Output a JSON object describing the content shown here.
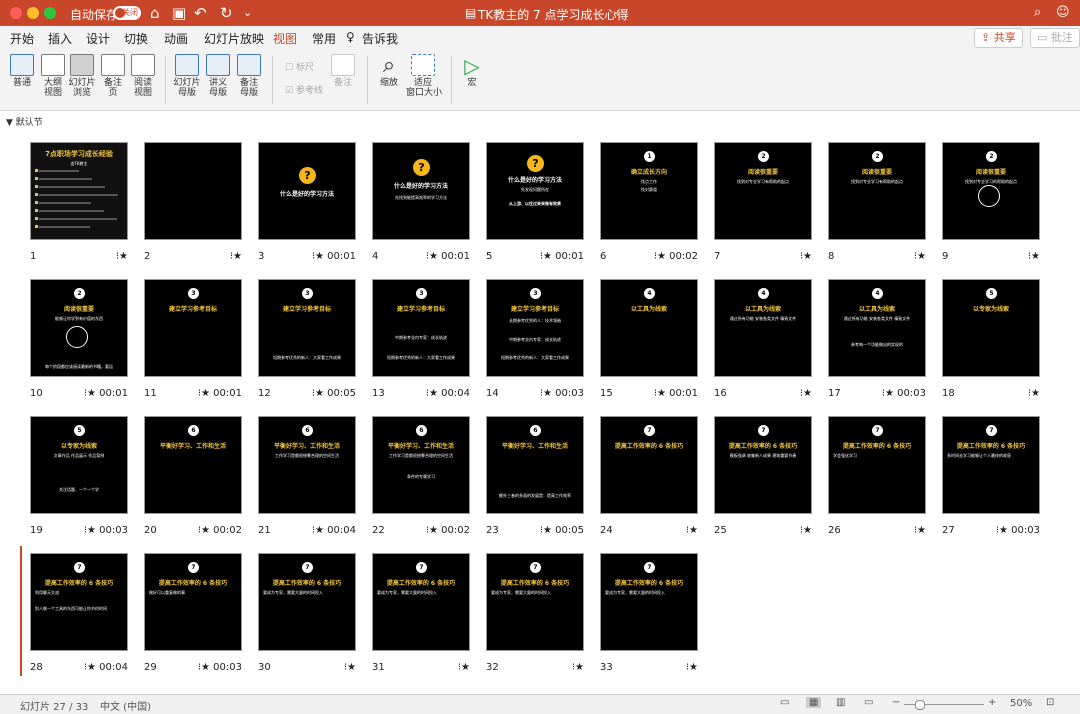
{
  "titlebar": {
    "autosave": "自动保存",
    "toggle": "关闭",
    "title": "TK教主的 7 点学习成长心得",
    "title_caret": "⌄"
  },
  "ribbon_tabs": [
    "开始",
    "插入",
    "设计",
    "切换",
    "动画",
    "幻灯片放映",
    "视图",
    "常用",
    "告诉我"
  ],
  "active_tab": "视图",
  "share": "共享",
  "comment": "批注",
  "toolbar": {
    "normal": "普通",
    "outline": "大纲\n视图",
    "sorter": "幻灯片\n浏览",
    "notes": "备注\n页",
    "reading": "阅读\n视图",
    "slide_master": "幻灯片\n母版",
    "handout_master": "讲义\n母版",
    "notes_master": "备注\n母版",
    "ruler": "标尺",
    "guides": "参考线",
    "notes2": "备注",
    "zoom": "缩放",
    "fit": "适应\n窗口大小",
    "macro": "宏"
  },
  "section": "默认节",
  "slides": [
    {
      "n": "1",
      "time": "",
      "star": true
    },
    {
      "n": "2",
      "time": "",
      "star": true
    },
    {
      "n": "3",
      "time": "00:01",
      "star": true
    },
    {
      "n": "4",
      "time": "00:01",
      "star": true
    },
    {
      "n": "5",
      "time": "00:01",
      "star": true
    },
    {
      "n": "6",
      "time": "00:02",
      "star": true
    },
    {
      "n": "7",
      "time": "",
      "star": true
    },
    {
      "n": "8",
      "time": "",
      "star": true
    },
    {
      "n": "9",
      "time": "",
      "star": true
    },
    {
      "n": "10",
      "time": "00:01",
      "star": true
    },
    {
      "n": "11",
      "time": "00:01",
      "star": true
    },
    {
      "n": "12",
      "time": "00:05",
      "star": true
    },
    {
      "n": "13",
      "time": "00:04",
      "star": true
    },
    {
      "n": "14",
      "time": "00:03",
      "star": true
    },
    {
      "n": "15",
      "time": "00:01",
      "star": true
    },
    {
      "n": "16",
      "time": "",
      "star": true
    },
    {
      "n": "17",
      "time": "00:03",
      "star": true
    },
    {
      "n": "18",
      "time": "",
      "star": true
    },
    {
      "n": "19",
      "time": "00:03",
      "star": true
    },
    {
      "n": "20",
      "time": "00:02",
      "star": true
    },
    {
      "n": "21",
      "time": "00:04",
      "star": true
    },
    {
      "n": "22",
      "time": "00:02",
      "star": true
    },
    {
      "n": "23",
      "time": "00:05",
      "star": true
    },
    {
      "n": "24",
      "time": "",
      "star": true
    },
    {
      "n": "25",
      "time": "",
      "star": true
    },
    {
      "n": "26",
      "time": "",
      "star": true
    },
    {
      "n": "27",
      "time": "00:03",
      "star": true
    },
    {
      "n": "28",
      "time": "00:04",
      "star": true
    },
    {
      "n": "29",
      "time": "00:03",
      "star": true
    },
    {
      "n": "30",
      "time": "",
      "star": true
    },
    {
      "n": "31",
      "time": "",
      "star": true
    },
    {
      "n": "32",
      "time": "",
      "star": true
    },
    {
      "n": "33",
      "time": "",
      "star": true
    }
  ],
  "slide_content": {
    "s1_title": "7点职场学习成长经验",
    "s1_sub": "由TK教主",
    "s3": "什么是好的学习方法",
    "s4": "什么是好的学习方法",
    "s4b": "先找到能提高效率的学习方法",
    "s5": "什么是好的学习方法",
    "s5b": "先发现问题所在",
    "s5c": "从上游、以往过来来做有效果",
    "s6": "确立成长方向",
    "s6b": "找点工作",
    "s6c": "找对赛道",
    "s7": "阅读很重要",
    "s7b": "找到对专业学习有帮助的起点",
    "s8": "阅读很重要",
    "s8b": "找到对专业学习有帮助的起点",
    "s9": "阅读很重要",
    "s9b": "找到对专业学习的帮助的起点",
    "s10": "阅读很重要",
    "s10b": "能够让你学到有价值的东西",
    "s10c": "每个阶段都应该阅读最新的书籍，要运",
    "s11": "建立学习参考目标",
    "s12": "建立学习参考目标",
    "s12b": "短期参考优秀的新人：大家看工作成果",
    "s13": "建立学习参考目标",
    "s13b": "中期参考业内专家：成长轨迹",
    "s13c": "短期参考优秀的新人：大家看工作成果",
    "s14": "建立学习参考目标",
    "s14b": "长期参考优秀的人：技术领袖",
    "s14c": "中期参考业内专家：成长轨迹",
    "s14d": "短期参考优秀的新人：大家看工作成果",
    "s15": "以工具为线索",
    "s16": "以工具为线索",
    "s16b": "通过所有功能    安装各类文件    精致文件",
    "s17": "以工具为线索",
    "s17b": "通过所有功能    安装各类文件    精致文件",
    "s17c": "参考每一个功能做出的实现的",
    "s18": "以专家为线索",
    "s19": "以专家为线索",
    "s19b": "文章作品    作品展示    作品案例",
    "s19c": "关注话题、一个一个学",
    "s20": "平衡好学习、工作和生活",
    "s21": "平衡好学习、工作和生活",
    "s21b": "工作学习是都很统筹合理的空间生活",
    "s22": "平衡好学习、工作和生活",
    "s22b": "工作学习是都很统筹合理的空间生活",
    "s22c": "条件的专属学习",
    "s23": "平衡好学习、工作和生活",
    "s23b": "额外三者的多面的发展是：提高工作效率",
    "s24": "提高工作效率的 6 条技巧",
    "s25": "提高工作效率的 6 条技巧",
    "s25b": "模板强调    收集新人成果    建筑重要节奏",
    "s26": "提高工作效率的 6 条技巧",
    "s26b": "学会强化学习",
    "s27": "提高工作效率的 6 条技巧",
    "s27b": "多时间去学习能够让个人最终的收获",
    "s28": "提高工作效率的 6 条技巧",
    "s28b": "利用聊天交流",
    "s28c": "别人做一个工具的东西可能让你节约时间",
    "s29": "提高工作效率的 6 条技巧",
    "s29b": "做好可以重复做的事",
    "s30": "提高工作效率的 6 条技巧",
    "s30b": "要成为专家，需要大量的时间投入",
    "s31": "提高工作效率的 6 条技巧",
    "s31b": "要成为专家，需要大量的时间投入",
    "s32": "提高工作效率的 6 条技巧",
    "s32b": "要成为专家，需要大量的时间投入",
    "s33": "提高工作效率的 6 条技巧",
    "s33b": "要成为专家，需要大量的时间投入"
  },
  "status": {
    "slide_count": "幻灯片 27 / 33",
    "language": "中文 (中国)",
    "zoom": "50%"
  },
  "colors": {
    "brand": "#c8472a",
    "accent_yellow": "#f2c33c"
  }
}
